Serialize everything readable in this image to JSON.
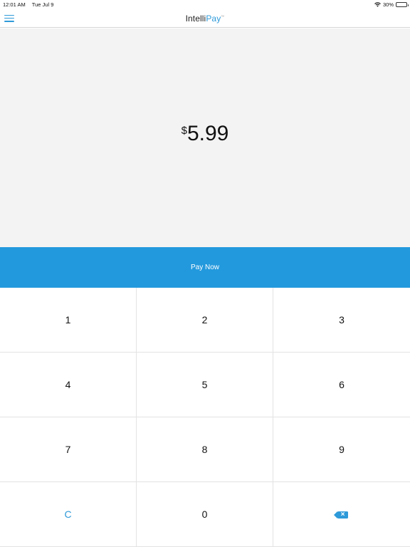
{
  "status_bar": {
    "time": "12:01 AM",
    "date": "Tue Jul 9",
    "battery": "30%",
    "wifi_icon": "wifi-icon",
    "battery_icon": "battery-icon"
  },
  "header": {
    "logo_part1": "Intelli",
    "logo_part2": "Pay",
    "logo_tm": "™",
    "menu_icon": "hamburger-menu-icon"
  },
  "amount": {
    "currency": "$",
    "value": "5.99"
  },
  "pay_button": {
    "label": "Pay Now"
  },
  "keypad": {
    "keys": [
      "1",
      "2",
      "3",
      "4",
      "5",
      "6",
      "7",
      "8",
      "9",
      "C",
      "0"
    ],
    "backspace_icon": "backspace-icon"
  },
  "colors": {
    "accent": "#2399dd",
    "amount_bg": "#f3f3f3",
    "divider": "#e3e3e3"
  }
}
